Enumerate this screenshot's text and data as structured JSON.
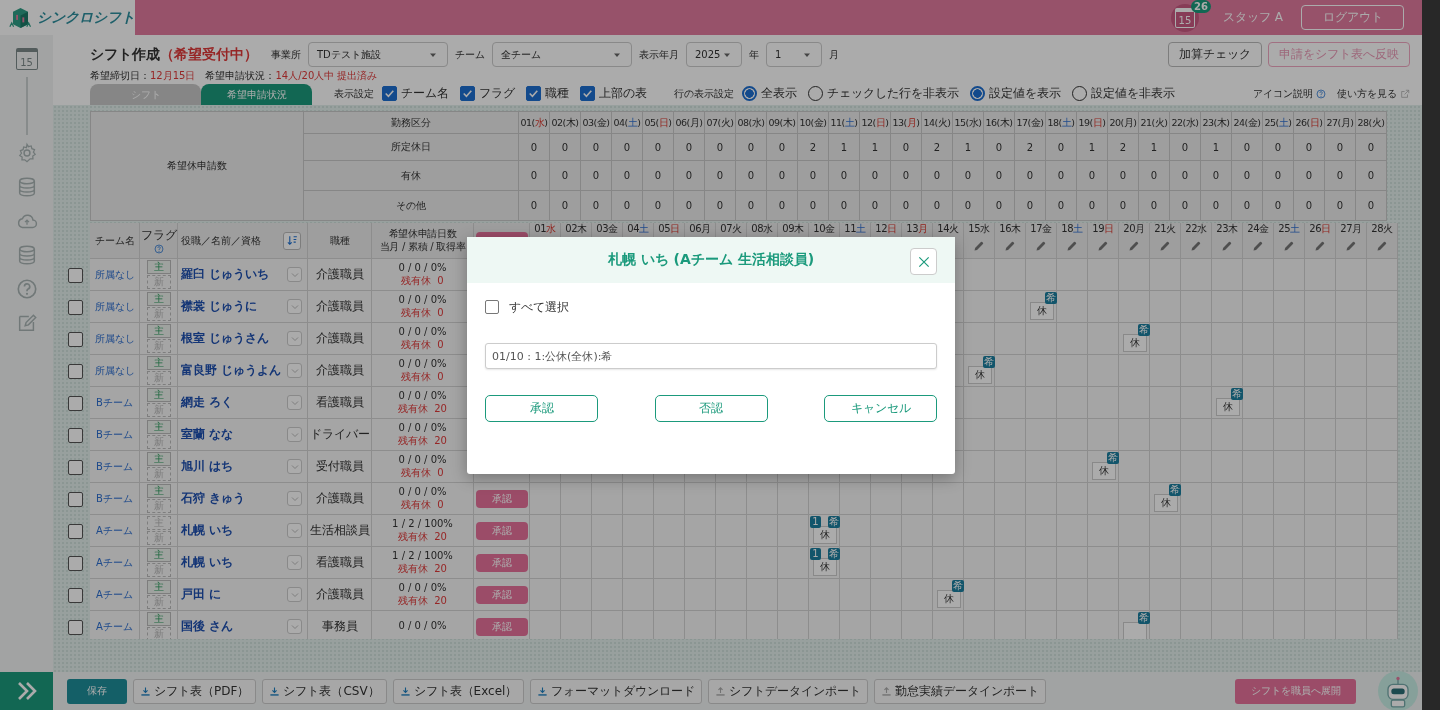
{
  "app": {
    "logo": "シンクロシフト",
    "calendar_day": "15",
    "notification_count": "26",
    "user": "スタッフ A",
    "logout": "ログアウト"
  },
  "sidebar": {
    "items": [
      {
        "kind": "calendar",
        "label": "15"
      },
      {
        "kind": "gear"
      },
      {
        "kind": "database"
      },
      {
        "kind": "cloud"
      },
      {
        "kind": "database"
      },
      {
        "kind": "help"
      },
      {
        "kind": "edit"
      }
    ]
  },
  "page": {
    "title": "シフト作成",
    "status": "（希望受付中）",
    "deadline_label": "希望締切日：",
    "deadline": "12月15日",
    "progress_label": "希望申請状況：",
    "progress": "14人/20人中 提出済み"
  },
  "filters": [
    {
      "label": "事業所",
      "value": "TDテスト施設"
    },
    {
      "label": "チーム",
      "value": "全チーム"
    },
    {
      "label": "表示年月",
      "value": "2025",
      "suffix": "年"
    },
    {
      "value": "1",
      "suffix": "月"
    }
  ],
  "actions": [
    {
      "label": "加算チェック",
      "disabled": false
    },
    {
      "label": "申請をシフト表へ反映",
      "disabled": true
    }
  ],
  "tabs": [
    {
      "label": "シフト",
      "selected": false
    },
    {
      "label": "希望申請状況",
      "selected": true
    }
  ],
  "display_settings": {
    "label": "表示設定",
    "options": [
      {
        "label": "チーム名",
        "checked": true
      },
      {
        "label": "フラグ",
        "checked": true
      },
      {
        "label": "職種",
        "checked": true
      },
      {
        "label": "上部の表",
        "checked": true
      }
    ]
  },
  "row_settings": {
    "label": "行の表示設定",
    "radios": [
      {
        "label": "全表示",
        "selected": true
      },
      {
        "label": "チェックした行を非表示",
        "selected": false
      },
      {
        "label": "設定値を表示",
        "selected": true
      },
      {
        "label": "設定値を非表示",
        "selected": false
      }
    ]
  },
  "links": [
    {
      "label": "アイコン説明",
      "kind": "help"
    },
    {
      "label": "使い方を見る",
      "kind": "external"
    }
  ],
  "summary": {
    "title": "希望休申請数",
    "header": "勤務区分",
    "days": [
      {
        "date": "01(",
        "weekday": "水",
        "end": ")",
        "kind": "holiday"
      },
      {
        "date": "02(",
        "weekday": "木",
        "end": ")",
        "kind": "weekday"
      },
      {
        "date": "03(",
        "weekday": "金",
        "end": ")",
        "kind": "weekday"
      },
      {
        "date": "04(",
        "weekday": "土",
        "end": ")",
        "kind": "sat"
      },
      {
        "date": "05(",
        "weekday": "日",
        "end": ")",
        "kind": "sun"
      },
      {
        "date": "06(",
        "weekday": "月",
        "end": ")",
        "kind": "weekday"
      },
      {
        "date": "07(",
        "weekday": "火",
        "end": ")",
        "kind": "weekday"
      },
      {
        "date": "08(",
        "weekday": "水",
        "end": ")",
        "kind": "weekday"
      },
      {
        "date": "09(",
        "weekday": "木",
        "end": ")",
        "kind": "weekday"
      },
      {
        "date": "10(",
        "weekday": "金",
        "end": ")",
        "kind": "weekday"
      },
      {
        "date": "11(",
        "weekday": "土",
        "end": ")",
        "kind": "sat"
      },
      {
        "date": "12(",
        "weekday": "日",
        "end": ")",
        "kind": "sun"
      },
      {
        "date": "13(",
        "weekday": "月",
        "end": ")",
        "kind": "holiday"
      },
      {
        "date": "14(",
        "weekday": "火",
        "end": ")",
        "kind": "weekday"
      },
      {
        "date": "15(",
        "weekday": "水",
        "end": ")",
        "kind": "weekday"
      },
      {
        "date": "16(",
        "weekday": "木",
        "end": ")",
        "kind": "weekday"
      },
      {
        "date": "17(",
        "weekday": "金",
        "end": ")",
        "kind": "weekday"
      },
      {
        "date": "18(",
        "weekday": "土",
        "end": ")",
        "kind": "sat"
      },
      {
        "date": "19(",
        "weekday": "日",
        "end": ")",
        "kind": "sun"
      },
      {
        "date": "20(",
        "weekday": "月",
        "end": ")",
        "kind": "weekday"
      },
      {
        "date": "21(",
        "weekday": "火",
        "end": ")",
        "kind": "weekday"
      },
      {
        "date": "22(",
        "weekday": "水",
        "end": ")",
        "kind": "weekday"
      },
      {
        "date": "23(",
        "weekday": "木",
        "end": ")",
        "kind": "weekday"
      },
      {
        "date": "24(",
        "weekday": "金",
        "end": ")",
        "kind": "weekday"
      },
      {
        "date": "25(",
        "weekday": "土",
        "end": ")",
        "kind": "sat"
      },
      {
        "date": "26(",
        "weekday": "日",
        "end": ")",
        "kind": "sun"
      },
      {
        "date": "27(",
        "weekday": "月",
        "end": ")",
        "kind": "weekday"
      },
      {
        "date": "28(",
        "weekday": "火",
        "end": ")",
        "kind": "weekday"
      }
    ],
    "rows": [
      {
        "label": "所定休日",
        "values": [
          "0",
          "0",
          "0",
          "0",
          "0",
          "0",
          "0",
          "0",
          "0",
          "2",
          "1",
          "1",
          "0",
          "2",
          "1",
          "0",
          "2",
          "0",
          "1",
          "2",
          "1",
          "0",
          "1",
          "0",
          "0",
          "0",
          "0",
          "0"
        ]
      },
      {
        "label": "有休",
        "values": [
          "0",
          "0",
          "0",
          "0",
          "0",
          "0",
          "0",
          "0",
          "0",
          "0",
          "0",
          "0",
          "0",
          "0",
          "0",
          "0",
          "0",
          "0",
          "0",
          "0",
          "0",
          "0",
          "0",
          "0",
          "0",
          "0",
          "0",
          "0"
        ]
      },
      {
        "label": "その他",
        "values": [
          "0",
          "0",
          "0",
          "0",
          "0",
          "0",
          "0",
          "0",
          "0",
          "0",
          "0",
          "0",
          "0",
          "0",
          "0",
          "0",
          "0",
          "0",
          "0",
          "0",
          "0",
          "0",
          "0",
          "0",
          "0",
          "0",
          "0",
          "0"
        ]
      }
    ]
  },
  "staff_table": {
    "columns": {
      "team": "チーム名",
      "flag": "フラグ",
      "name": "役職／名前／資格",
      "job": "職種",
      "count": "希望休申請日数",
      "count_sub": "当月 / 累積 / 取得率"
    },
    "days": [
      {
        "date": "01",
        "weekday": "水",
        "kind": "holiday",
        "editable": false
      },
      {
        "date": "02",
        "weekday": "木",
        "kind": "weekday",
        "editable": false
      },
      {
        "date": "03",
        "weekday": "金",
        "kind": "weekday",
        "editable": false
      },
      {
        "date": "04",
        "weekday": "土",
        "kind": "sat",
        "editable": false
      },
      {
        "date": "05",
        "weekday": "日",
        "kind": "sun",
        "editable": false
      },
      {
        "date": "06",
        "weekday": "月",
        "kind": "weekday",
        "editable": false
      },
      {
        "date": "07",
        "weekday": "火",
        "kind": "weekday",
        "editable": false
      },
      {
        "date": "08",
        "weekday": "水",
        "kind": "weekday",
        "editable": false
      },
      {
        "date": "09",
        "weekday": "木",
        "kind": "weekday",
        "editable": false
      },
      {
        "date": "10",
        "weekday": "金",
        "kind": "weekday",
        "editable": false
      },
      {
        "date": "11",
        "weekday": "土",
        "kind": "sat",
        "editable": false
      },
      {
        "date": "12",
        "weekday": "日",
        "kind": "sun",
        "editable": false
      },
      {
        "date": "13",
        "weekday": "月",
        "kind": "holiday",
        "editable": false
      },
      {
        "date": "14",
        "weekday": "火",
        "kind": "weekday",
        "editable": false
      },
      {
        "date": "15",
        "weekday": "水",
        "kind": "weekday",
        "editable": true
      },
      {
        "date": "16",
        "weekday": "木",
        "kind": "weekday",
        "editable": true
      },
      {
        "date": "17",
        "weekday": "金",
        "kind": "weekday",
        "editable": true
      },
      {
        "date": "18",
        "weekday": "土",
        "kind": "sat",
        "editable": true
      },
      {
        "date": "19",
        "weekday": "日",
        "kind": "sun",
        "editable": true
      },
      {
        "date": "20",
        "weekday": "月",
        "kind": "weekday",
        "editable": true
      },
      {
        "date": "21",
        "weekday": "火",
        "kind": "weekday",
        "editable": true
      },
      {
        "date": "22",
        "weekday": "水",
        "kind": "weekday",
        "editable": true
      },
      {
        "date": "23",
        "weekday": "木",
        "kind": "weekday",
        "editable": true
      },
      {
        "date": "24",
        "weekday": "金",
        "kind": "weekday",
        "editable": true
      },
      {
        "date": "25",
        "weekday": "土",
        "kind": "sat",
        "editable": true
      },
      {
        "date": "26",
        "weekday": "日",
        "kind": "sun",
        "editable": true
      },
      {
        "date": "27",
        "weekday": "月",
        "kind": "weekday",
        "editable": true
      },
      {
        "date": "28",
        "weekday": "火",
        "kind": "weekday",
        "editable": true
      }
    ],
    "rows": [
      {
        "checked": false,
        "team": "所属なし",
        "main": "主",
        "main_on": true,
        "new": "新",
        "new_on": false,
        "name": "羅臼 じゅういち",
        "job": "介護職員",
        "counts": "0 / 0 / 0%",
        "remaining_label": "残有休",
        "remaining": "0",
        "cells": [
          null,
          null,
          null,
          null,
          null,
          null,
          null,
          null,
          null,
          null,
          null,
          null,
          null,
          null,
          null,
          null,
          null,
          null,
          null,
          null,
          null,
          null,
          null,
          null,
          null,
          null,
          null,
          null
        ]
      },
      {
        "checked": false,
        "team": "所属なし",
        "main": "主",
        "main_on": true,
        "new": "新",
        "new_on": false,
        "name": "襟裳 じゅうに",
        "job": "介護職員",
        "counts": "0 / 0 / 0%",
        "remaining_label": "残有休",
        "remaining": "0",
        "cells": [
          null,
          null,
          null,
          null,
          null,
          null,
          null,
          null,
          null,
          null,
          null,
          null,
          null,
          null,
          null,
          null,
          {
            "label": "休",
            "badge": "希"
          },
          null,
          null,
          null,
          null,
          null,
          null,
          null,
          null,
          null,
          null,
          null
        ]
      },
      {
        "checked": false,
        "team": "所属なし",
        "main": "主",
        "main_on": true,
        "new": "新",
        "new_on": false,
        "name": "根室 じゅうさん",
        "job": "介護職員",
        "counts": "0 / 0 / 0%",
        "remaining_label": "残有休",
        "remaining": "0",
        "cells": [
          null,
          null,
          null,
          null,
          null,
          null,
          null,
          null,
          null,
          null,
          null,
          null,
          null,
          null,
          null,
          null,
          null,
          null,
          null,
          {
            "label": "休",
            "badge": "希"
          },
          null,
          null,
          null,
          null,
          null,
          null,
          null,
          null
        ]
      },
      {
        "checked": false,
        "team": "所属なし",
        "main": "主",
        "main_on": true,
        "new": "新",
        "new_on": false,
        "name": "富良野 じゅうよん",
        "job": "介護職員",
        "counts": "0 / 0 / 0%",
        "remaining_label": "残有休",
        "remaining": "0",
        "cells": [
          null,
          null,
          null,
          null,
          null,
          null,
          null,
          null,
          null,
          null,
          null,
          null,
          null,
          null,
          {
            "label": "休",
            "badge": "希"
          },
          null,
          null,
          null,
          null,
          null,
          null,
          null,
          null,
          null,
          null,
          null,
          null,
          null
        ]
      },
      {
        "checked": false,
        "team": "Bチーム",
        "main": "主",
        "main_on": true,
        "new": "新",
        "new_on": false,
        "name": "網走 ろく",
        "job": "看護職員",
        "counts": "0 / 0 / 0%",
        "remaining_label": "残有休",
        "remaining": "20",
        "cells": [
          null,
          null,
          null,
          null,
          null,
          null,
          null,
          null,
          null,
          null,
          null,
          null,
          null,
          null,
          null,
          null,
          null,
          null,
          null,
          null,
          null,
          null,
          {
            "label": "休",
            "badge": "希"
          },
          null,
          null,
          null,
          null,
          null
        ]
      },
      {
        "checked": false,
        "team": "Bチーム",
        "main": "主",
        "main_on": true,
        "new": "新",
        "new_on": false,
        "name": "室蘭 なな",
        "job": "ドライバー",
        "counts": "0 / 0 / 0%",
        "remaining_label": "残有休",
        "remaining": "20",
        "cells": [
          null,
          null,
          null,
          null,
          null,
          null,
          null,
          null,
          null,
          null,
          null,
          null,
          null,
          null,
          null,
          null,
          null,
          null,
          null,
          null,
          null,
          null,
          null,
          null,
          null,
          null,
          null,
          null
        ]
      },
      {
        "checked": false,
        "team": "Bチーム",
        "main": "主",
        "main_on": true,
        "new": "新",
        "new_on": false,
        "name": "旭川 はち",
        "job": "受付職員",
        "counts": "0 / 0 / 0%",
        "remaining_label": "残有休",
        "remaining": "0",
        "cells": [
          null,
          null,
          null,
          null,
          null,
          null,
          null,
          null,
          null,
          null,
          null,
          null,
          null,
          null,
          null,
          null,
          null,
          null,
          {
            "label": "休",
            "badge": "希"
          },
          null,
          null,
          null,
          null,
          null,
          null,
          null,
          null,
          null
        ]
      },
      {
        "checked": false,
        "team": "Bチーム",
        "main": "主",
        "main_on": true,
        "new": "新",
        "new_on": false,
        "name": "石狩 きゅう",
        "job": "介護職員",
        "counts": "0 / 0 / 0%",
        "remaining_label": "残有休",
        "remaining": "0",
        "approve": "承認",
        "cells": [
          null,
          null,
          null,
          null,
          null,
          null,
          null,
          null,
          null,
          null,
          null,
          null,
          null,
          null,
          null,
          null,
          null,
          null,
          null,
          null,
          {
            "label": "休",
            "badge": "希"
          },
          null,
          null,
          null,
          null,
          null,
          null,
          null
        ]
      },
      {
        "checked": false,
        "team": "Aチーム",
        "main": "主",
        "main_on": false,
        "new": "新",
        "new_on": false,
        "name": "札幌 いち",
        "job": "生活相談員",
        "counts": "1 / 2 / 100%",
        "remaining_label": "残有休",
        "remaining": "20",
        "approve": "承認",
        "cells": [
          null,
          null,
          null,
          null,
          null,
          null,
          null,
          null,
          null,
          {
            "label": "休",
            "count": "1",
            "badge": "希"
          },
          null,
          null,
          null,
          null,
          null,
          null,
          null,
          null,
          null,
          null,
          null,
          null,
          null,
          null,
          null,
          null,
          null,
          null
        ]
      },
      {
        "checked": false,
        "team": "Aチーム",
        "main": "主",
        "main_on": true,
        "new": "新",
        "new_on": false,
        "name": "札幌 いち",
        "job": "看護職員",
        "counts": "1 / 2 / 100%",
        "remaining_label": "残有休",
        "remaining": "20",
        "approve": "承認",
        "cells": [
          null,
          null,
          null,
          null,
          null,
          null,
          null,
          null,
          null,
          {
            "label": "休",
            "count": "1",
            "badge": "希"
          },
          null,
          null,
          null,
          null,
          null,
          null,
          null,
          null,
          null,
          null,
          null,
          null,
          null,
          null,
          null,
          null,
          null,
          null
        ]
      },
      {
        "checked": false,
        "team": "Aチーム",
        "main": "主",
        "main_on": true,
        "new": "新",
        "new_on": false,
        "name": "戸田 に",
        "job": "介護職員",
        "counts": "0 / 0 / 0%",
        "remaining_label": "残有休",
        "remaining": "20",
        "approve": "承認",
        "cells": [
          null,
          null,
          null,
          null,
          null,
          null,
          null,
          null,
          null,
          null,
          null,
          null,
          null,
          {
            "label": "休",
            "badge": "希"
          },
          null,
          null,
          null,
          null,
          null,
          null,
          null,
          null,
          null,
          null,
          null,
          null,
          null,
          null
        ]
      },
      {
        "checked": false,
        "team": "Aチーム",
        "main": "主",
        "main_on": true,
        "new": "新",
        "new_on": false,
        "name": "国後 さん",
        "job": "事務員",
        "counts": "0 / 0 / 0%",
        "approve": "承認",
        "cells": [
          null,
          null,
          null,
          null,
          null,
          null,
          null,
          null,
          null,
          null,
          null,
          null,
          null,
          null,
          null,
          null,
          null,
          null,
          null,
          {
            "badge": "希"
          },
          null,
          null,
          null,
          null,
          null,
          null,
          null,
          null
        ]
      }
    ]
  },
  "bottom_bar": {
    "save": "保存",
    "buttons": [
      {
        "label": "シフト表（PDF）",
        "kind": "export"
      },
      {
        "label": "シフト表（CSV）",
        "kind": "export"
      },
      {
        "label": "シフト表（Excel）",
        "kind": "export"
      },
      {
        "label": "フォーマットダウンロード",
        "kind": "export"
      },
      {
        "label": "シフトデータインポート",
        "kind": "import"
      },
      {
        "label": "勤怠実績データインポート",
        "kind": "import"
      }
    ],
    "publish": "シフトを職員へ展開"
  },
  "modal": {
    "title": "札幌 いち (Aチーム 生活相談員)",
    "select_all": {
      "label": "すべて選択",
      "checked": false
    },
    "request": "01/10 : 1:公休(全休):希",
    "buttons": [
      "承認",
      "否認",
      "キャンセル"
    ]
  }
}
